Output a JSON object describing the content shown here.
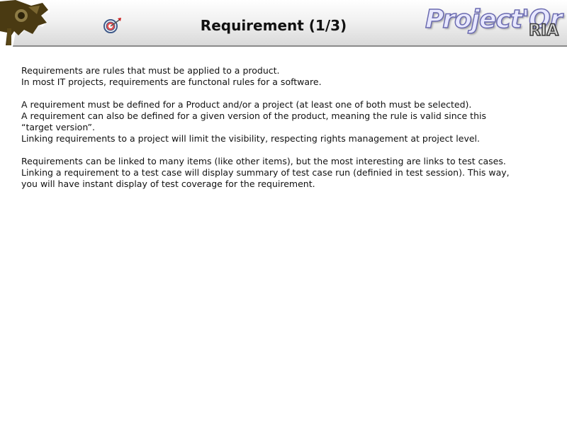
{
  "header": {
    "title": "Requirement (1/3)",
    "brand_main": "Project'Or",
    "brand_sub": "RIA",
    "logo_icon": "projector-logo-icon",
    "target_icon": "target-icon"
  },
  "content": {
    "paragraphs": [
      {
        "lines": [
          "Requirements are rules that must be applied to a product.",
          "In most IT projects, requirements are functonal rules for a software."
        ]
      },
      {
        "lines": [
          "A requirement must be defined for a Product and/or a project (at least one of both must be selected).",
          "A requirement can also be defined for a given version of the product, meaning the rule is valid since this",
          "“target version”.",
          "Linking requirements to a project will limit the visibility, respecting rights management at project level."
        ]
      },
      {
        "lines": [
          "Requirements can be linked to many items (like other items), but the most interesting are links to test cases.",
          "Linking a requirement to a test case will display summary of test case run (definied in test session). This way,",
          "you will have instant display of test coverage for the requirement."
        ]
      }
    ]
  },
  "colors": {
    "header_top": "#ffffff",
    "header_bottom": "#d9d9d9",
    "logo_brown": "#4a3a12",
    "brand_stroke": "#6b6bb0"
  }
}
